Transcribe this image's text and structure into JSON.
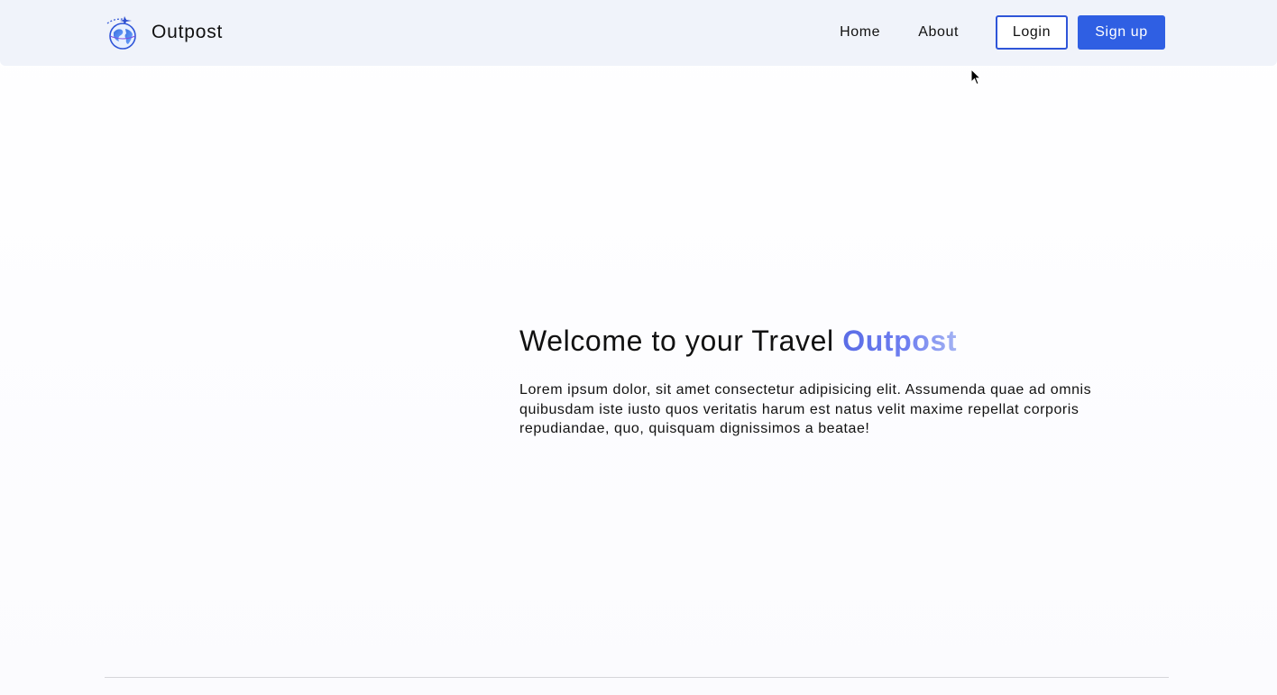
{
  "brand": {
    "name": "Outpost",
    "logo_icon": "globe-airplane-icon"
  },
  "nav": {
    "links": [
      {
        "label": "Home"
      },
      {
        "label": "About"
      }
    ],
    "login_label": "Login",
    "signup_label": "Sign up"
  },
  "hero": {
    "title_prefix": "Welcome to your Travel ",
    "title_accent": "Outpost",
    "body": "Lorem ipsum dolor, sit amet consectetur adipisicing elit. Assumenda quae ad omnis quibusdam iste iusto quos veritatis harum est natus velit maxime repellat corporis repudiandae, quo, quisquam dignissimos a beatae!"
  },
  "colors": {
    "navbar_background": "#f0f3fa",
    "primary_button": "#2f5fe3",
    "login_border": "#2f55d8",
    "accent_gradient_start": "#5a6ce6",
    "accent_gradient_end": "#a4b3f3"
  }
}
